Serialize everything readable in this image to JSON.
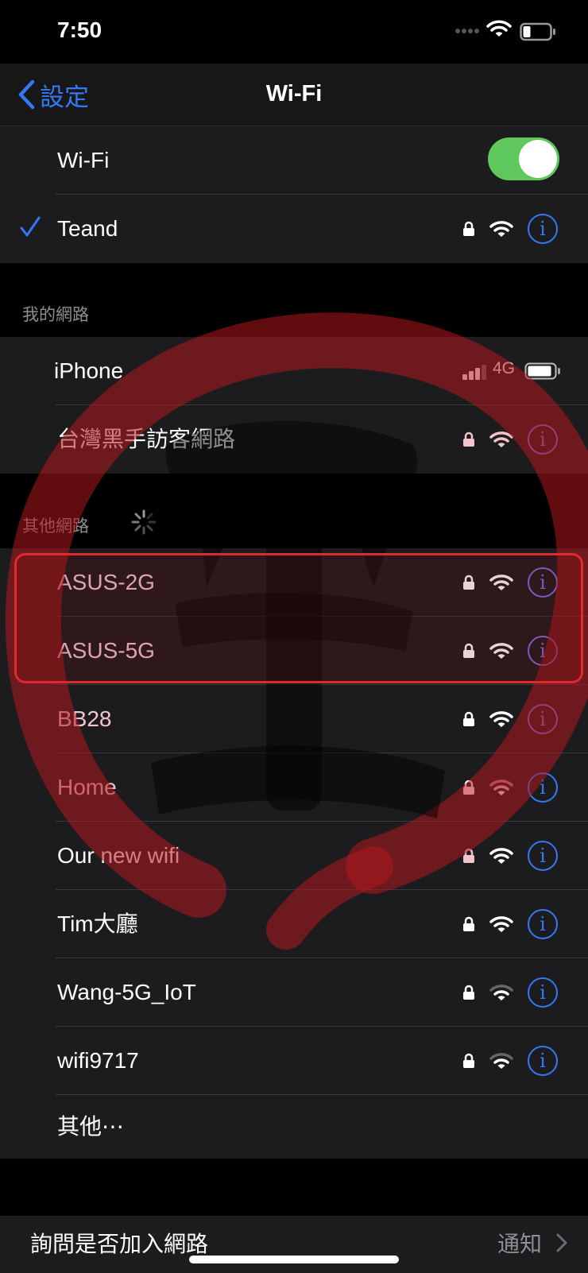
{
  "status_bar": {
    "time": "7:50"
  },
  "nav": {
    "back_label": "設定",
    "title": "Wi-Fi"
  },
  "wifi_toggle": {
    "label": "Wi-Fi",
    "on": true
  },
  "connected": {
    "name": "Teand"
  },
  "my_networks": {
    "header": "我的網路",
    "hotspot": {
      "name": "iPhone",
      "network_type": "4G"
    },
    "items": [
      {
        "name": "台灣黑手訪客網路"
      }
    ]
  },
  "other_networks": {
    "header": "其他網路",
    "items": [
      {
        "name": "ASUS-2G"
      },
      {
        "name": "ASUS-5G"
      },
      {
        "name": "BB28"
      },
      {
        "name": "Home"
      },
      {
        "name": "Our new wifi"
      },
      {
        "name": "Tim大廳"
      },
      {
        "name": "Wang-5G_IoT"
      },
      {
        "name": "wifi9717"
      }
    ],
    "other_label": "其他⋯"
  },
  "ask_to_join": {
    "label": "詢問是否加入網路",
    "value": "通知"
  },
  "colors": {
    "accent": "#3478f6",
    "toggle_on": "#5fc85c",
    "highlight": "#e0282f"
  }
}
